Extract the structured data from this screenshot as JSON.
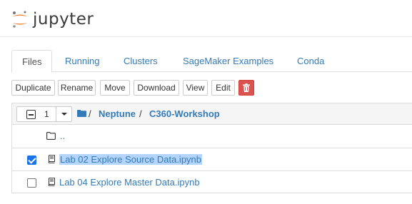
{
  "header": {
    "brand": "jupyter"
  },
  "tabs": [
    {
      "label": "Files",
      "active": true
    },
    {
      "label": "Running",
      "active": false
    },
    {
      "label": "Clusters",
      "active": false
    },
    {
      "label": "SageMaker Examples",
      "active": false
    },
    {
      "label": "Conda",
      "active": false
    }
  ],
  "toolbar": {
    "duplicate": "Duplicate",
    "rename": "Rename",
    "move": "Move",
    "download": "Download",
    "view": "View",
    "edit": "Edit",
    "delete_icon": "trash-icon"
  },
  "listing": {
    "selected_count": "1",
    "breadcrumb": [
      {
        "label": "Neptune"
      },
      {
        "label": "C360-Workshop"
      }
    ],
    "separator": "/",
    "parent_dir": "..",
    "items": [
      {
        "name": "Lab 02 Explore Source Data.ipynb",
        "checked": true,
        "icon": "notebook-icon"
      },
      {
        "name": "Lab 04 Explore Master Data.ipynb",
        "checked": false,
        "icon": "notebook-icon"
      }
    ]
  },
  "colors": {
    "link": "#337ab7",
    "accent_orange": "#f37726",
    "danger": "#d9534f",
    "selection": "#b3d4fc",
    "checkbox_checked": "#1a73e8"
  }
}
